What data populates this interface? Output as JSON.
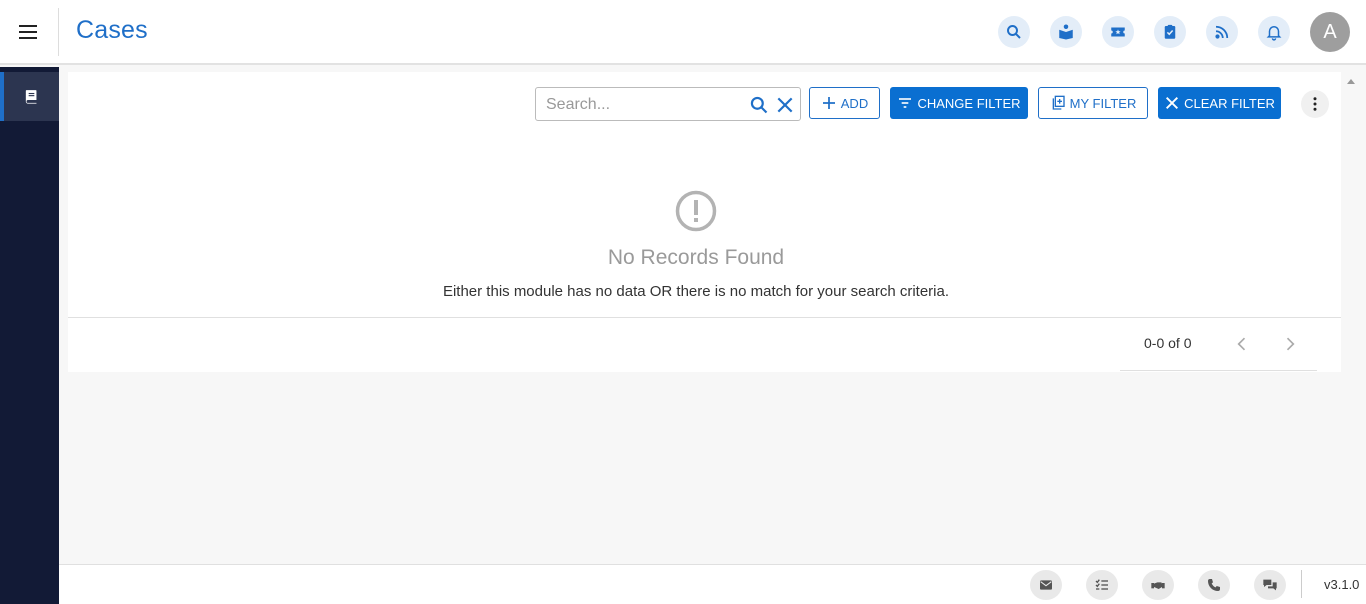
{
  "header": {
    "title": "Cases",
    "avatar_initial": "A",
    "icons": [
      "search-icon",
      "knowledge-icon",
      "ticket-icon",
      "task-check-icon",
      "feed-icon",
      "bell-icon"
    ]
  },
  "sidebar": {
    "items": [
      {
        "icon": "book-icon",
        "active": true
      }
    ]
  },
  "toolbar": {
    "search_placeholder": "Search...",
    "add_label": "ADD",
    "change_filter_label": "CHANGE FILTER",
    "my_filter_label": "MY FILTER",
    "clear_filter_label": "CLEAR FILTER"
  },
  "empty_state": {
    "title": "No Records Found",
    "message": "Either this module has no data OR there is no match for your search criteria."
  },
  "pagination": {
    "range_text": "0-0 of 0"
  },
  "footer": {
    "icons": [
      "email-icon",
      "checklist-icon",
      "meeting-icon",
      "phone-icon",
      "chat-icon"
    ],
    "version": "v3.1.0"
  },
  "colors": {
    "primary": "#0a6fd1",
    "title_blue": "#1f6fc8",
    "sidebar_bg": "#121a36",
    "icon_bubble": "#e3edf8"
  }
}
